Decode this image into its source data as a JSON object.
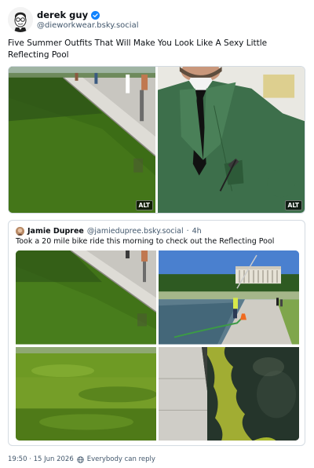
{
  "post": {
    "author": {
      "display_name": "derek guy",
      "handle": "@dieworkwear.bsky.social",
      "verified": true,
      "avatar_icon": "avatar-sketch-glasses-icon"
    },
    "text": "Five Summer Outfits That Will Make You Look Like A Sexy Little Reflecting Pool",
    "media": [
      {
        "kind": "photo",
        "subject": "reflecting-pool-walkway",
        "alt_label": "ALT"
      },
      {
        "kind": "photo",
        "subject": "green-suit-jacket",
        "alt_label": "ALT"
      }
    ]
  },
  "quote": {
    "author": {
      "display_name": "Jamie Dupree",
      "handle": "@jamiedupree.bsky.social",
      "separator": "·",
      "time": "4h"
    },
    "text": "Took a 20 mile bike ride this morning to check out the Reflecting Pool",
    "media": [
      {
        "kind": "photo",
        "subject": "reflecting-pool-walkway"
      },
      {
        "kind": "photo",
        "subject": "lincoln-memorial-workers"
      },
      {
        "kind": "photo",
        "subject": "green-water-closeup"
      },
      {
        "kind": "photo",
        "subject": "algae-edge-closeup"
      }
    ]
  },
  "footer": {
    "timestamp": "19:50 · 15 Jun 2026",
    "reply_setting": "Everybody can reply",
    "reply_icon": "globe-icon"
  },
  "colors": {
    "text_primary": "#0b0f14",
    "text_secondary": "#42576c",
    "border": "#d4dbe2",
    "verified_blue": "#1083fe"
  }
}
